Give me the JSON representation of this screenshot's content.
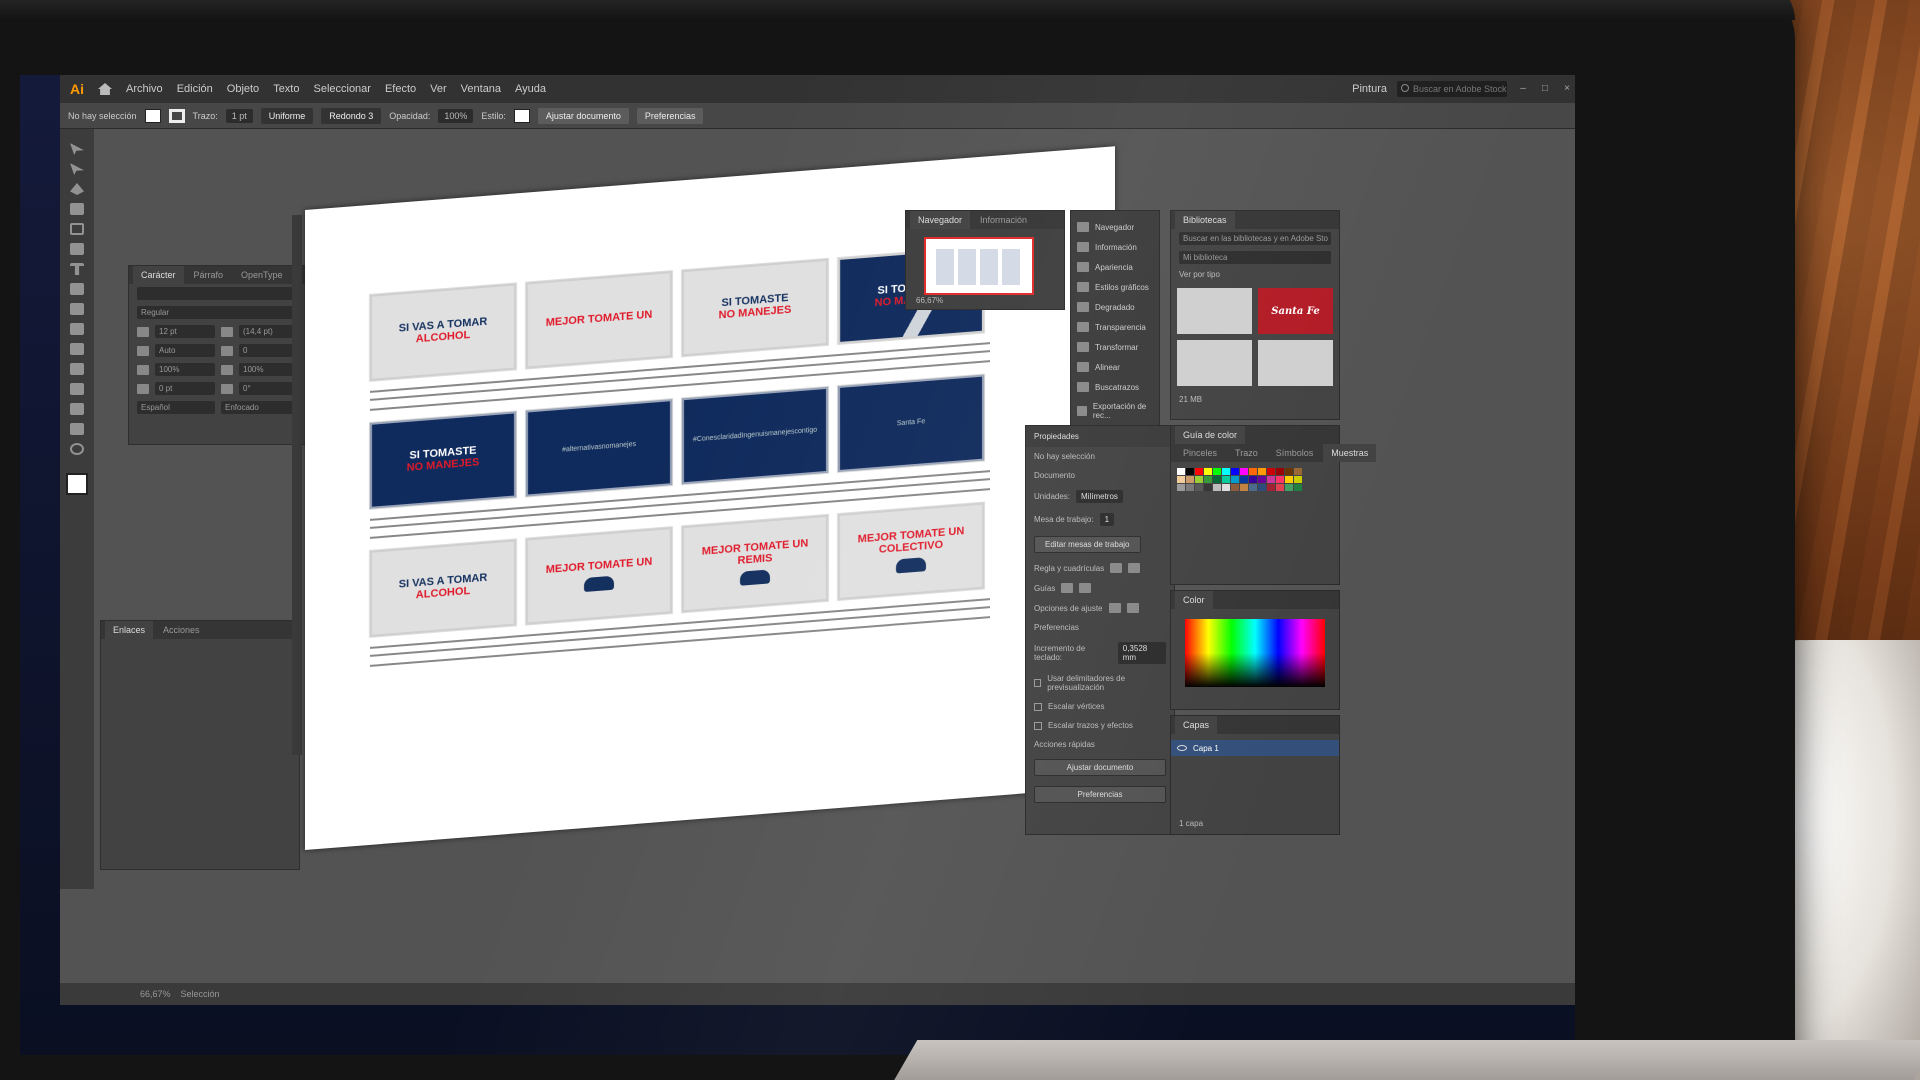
{
  "menu": {
    "items": [
      "Archivo",
      "Edición",
      "Objeto",
      "Texto",
      "Seleccionar",
      "Efecto",
      "Ver",
      "Ventana",
      "Ayuda"
    ],
    "workspace": "Pintura",
    "search_placeholder": "Buscar en Adobe Stock"
  },
  "control_bar": {
    "selection_status": "No hay selección",
    "stroke_label": "Trazo:",
    "stroke_value": "1 pt",
    "stroke_style": "Uniforme",
    "brush": "Redondo 3",
    "opacity_label": "Opacidad:",
    "opacity_value": "100%",
    "style_label": "Estilo:",
    "fit_button": "Ajustar documento",
    "prefs_button": "Preferencias"
  },
  "character_panel": {
    "tabs": [
      "Carácter",
      "Párrafo",
      "OpenType"
    ],
    "font_style": "Regular",
    "font_size": "12 pt",
    "leading": "(14,4 pt)",
    "kerning": "Auto",
    "tracking": "0",
    "scale_v": "100%",
    "scale_h": "100%",
    "baseline": "0 pt",
    "rotation": "0°",
    "language": "Español",
    "anti_alias": "Enfocado"
  },
  "left_panel_2": {
    "tabs": [
      "Enlaces",
      "Acciones"
    ]
  },
  "artboards": [
    [
      {
        "lines": [
          "SI VAS A TOMAR",
          "ALCOHOL"
        ],
        "style": "light"
      },
      {
        "lines": [
          "MEJOR TOMATE UN"
        ],
        "style": "light"
      },
      {
        "lines": [
          "SI TOMASTE",
          "NO MANEJES"
        ],
        "style": "light"
      },
      {
        "lines": [
          "SI TOMASTE",
          "NO MANEJES"
        ],
        "style": "diag"
      }
    ],
    [
      {
        "lines": [
          "SI TOMASTE",
          "NO MANEJES"
        ],
        "style": "navy"
      },
      {
        "lines": [
          "#alternativasnomanejes"
        ],
        "style": "navy-small"
      },
      {
        "lines": [
          "#ConesclaridadIngenuismanejescontigo"
        ],
        "style": "navy-small"
      },
      {
        "lines": [
          "Santa Fe"
        ],
        "style": "navy-small"
      }
    ],
    [
      {
        "lines": [
          "SI VAS A TOMAR",
          "ALCOHOL"
        ],
        "style": "light"
      },
      {
        "lines": [
          "MEJOR TOMATE UN"
        ],
        "style": "light-car"
      },
      {
        "lines": [
          "MEJOR TOMATE UN",
          "REMIS"
        ],
        "style": "light-car"
      },
      {
        "lines": [
          "MEJOR TOMATE UN",
          "COLECTIVO"
        ],
        "style": "light-car"
      }
    ]
  ],
  "navigator": {
    "tabs": [
      "Navegador",
      "Información"
    ],
    "zoom": "66,67%"
  },
  "icon_column": [
    "Navegador",
    "Información",
    "Apariencia",
    "Estilos gráficos",
    "Degradado",
    "Transparencia",
    "Transformar",
    "Alinear",
    "Buscatrazos",
    "Exportación de rec..."
  ],
  "properties": {
    "title": "Propiedades",
    "status": "No hay selección",
    "document_label": "Documento",
    "units_label": "Unidades:",
    "units_value": "Milímetros",
    "artboard_label": "Mesa de trabajo:",
    "artboard_value": "1",
    "edit_artboards": "Editar mesas de trabajo",
    "rulers_label": "Regla y cuadrículas",
    "guides_label": "Guías",
    "snap_label": "Opciones de ajuste",
    "prefs_label": "Preferencias",
    "keyboard_inc_label": "Incremento de teclado:",
    "keyboard_inc_value": "0,3528 mm",
    "check1": "Usar delimitadores de previsualización",
    "check2": "Escalar vértices",
    "check3": "Escalar trazos y efectos",
    "quick_actions": "Acciones rápidas",
    "fit_doc": "Ajustar documento",
    "prefs_btn": "Preferencias"
  },
  "libraries": {
    "title": "Bibliotecas",
    "search": "Buscar en las bibliotecas y en Adobe Sto",
    "library": "Mi biblioteca",
    "view": "Ver por tipo",
    "item_red": "Santa Fe",
    "size": "21 MB"
  },
  "swatches": {
    "guide_tab": "Guía de color",
    "tabs": [
      "Pinceles",
      "Trazo",
      "Símbolos",
      "Muestras"
    ],
    "colors": [
      "#ffffff",
      "#000000",
      "#ff0000",
      "#ffff00",
      "#00ff00",
      "#00ffff",
      "#0000ff",
      "#ff00ff",
      "#ff6600",
      "#ff9900",
      "#cc0000",
      "#990000",
      "#663300",
      "#996633",
      "#f2cc99",
      "#cc9966",
      "#99cc33",
      "#339933",
      "#006633",
      "#00cc99",
      "#0099cc",
      "#003399",
      "#330099",
      "#660099",
      "#cc3399",
      "#ff3366",
      "#ffcc00",
      "#cccc00",
      "#999999",
      "#777777",
      "#555555",
      "#333333",
      "#bbbbbb",
      "#dddddd",
      "#8a5a3a",
      "#c08040",
      "#4a6a8a",
      "#2a4a7a",
      "#a02030",
      "#e04050",
      "#40a060",
      "#208040"
    ]
  },
  "color_panel": {
    "title": "Color"
  },
  "layers": {
    "title": "Capas",
    "layer1": "Capa 1",
    "count": "1 capa"
  },
  "status": {
    "zoom": "66,67%",
    "tool": "Selección"
  }
}
